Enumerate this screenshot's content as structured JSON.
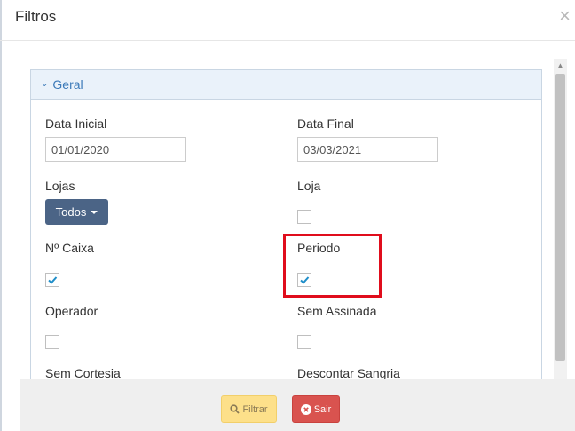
{
  "modal": {
    "title": "Filtros",
    "close_glyph": "×"
  },
  "panel": {
    "heading": "Geral",
    "chevron_glyph": "⌄"
  },
  "fields": {
    "data_inicial": {
      "label": "Data Inicial",
      "value": "01/01/2020"
    },
    "data_final": {
      "label": "Data Final",
      "value": "03/03/2021"
    },
    "lojas": {
      "label": "Lojas",
      "button_label": "Todos"
    },
    "loja": {
      "label": "Loja",
      "checked": false
    },
    "n_caixa": {
      "label": "Nº Caixa",
      "checked": true
    },
    "periodo": {
      "label": "Periodo",
      "checked": true
    },
    "operador": {
      "label": "Operador",
      "checked": false
    },
    "sem_assinada": {
      "label": "Sem Assinada",
      "checked": false
    },
    "sem_cortesia": {
      "label": "Sem Cortesia"
    },
    "descontar_sangria": {
      "label": "Descontar Sangria"
    }
  },
  "footer": {
    "filtrar_label": "Filtrar",
    "sair_label": "Sair"
  },
  "icons": {
    "close": "close-icon",
    "chevron": "chevron-down-icon",
    "caret": "caret-down-icon",
    "check": "check-icon",
    "search": "search-icon",
    "times_circle": "times-circle-icon"
  },
  "colors": {
    "accent_blue": "#3b79b8",
    "button_dark": "#4b6486",
    "highlight_red": "#e00d1c",
    "filtrar_bg": "#fde08a",
    "sair_bg": "#d9534f",
    "check_blue": "#1f8ec9"
  }
}
